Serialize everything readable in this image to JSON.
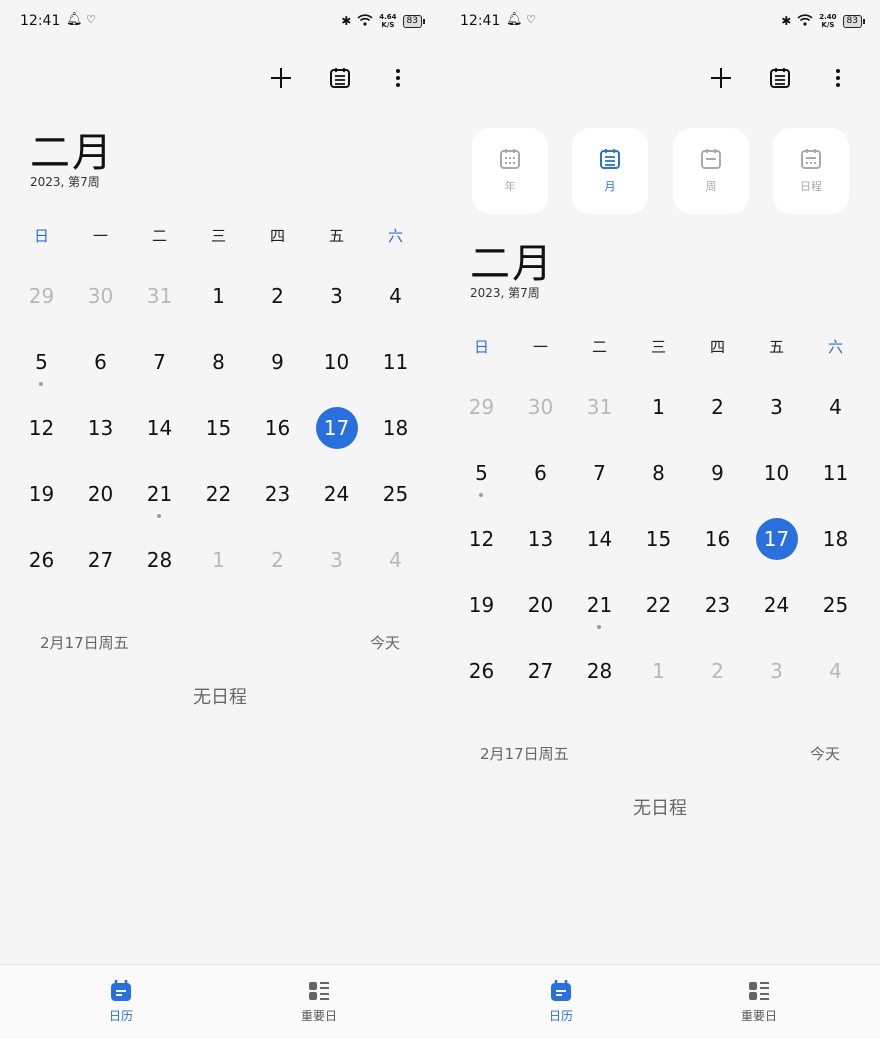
{
  "colors": {
    "accent": "#2a6fde",
    "muted": "#b8b8b8",
    "text": "#111111"
  },
  "status_bar": {
    "time": "12:41",
    "battery": "83",
    "speed_left": {
      "value": "4.64",
      "unit": "K/S"
    },
    "speed_right": {
      "value": "2.40",
      "unit": "K/S"
    },
    "icons": [
      "bell-icon",
      "heart-icon",
      "bluetooth-icon",
      "wifi-icon",
      "battery-icon"
    ]
  },
  "toolbar": {
    "icons": [
      "add-icon",
      "calendar-today-icon",
      "more-vertical-icon"
    ]
  },
  "view_switch": {
    "items": [
      {
        "label": "年",
        "icon": "calendar-year-icon",
        "active": false
      },
      {
        "label": "月",
        "icon": "calendar-month-icon",
        "active": true
      },
      {
        "label": "周",
        "icon": "calendar-week-icon",
        "active": false
      },
      {
        "label": "日程",
        "icon": "calendar-agenda-icon",
        "active": false
      }
    ]
  },
  "header": {
    "month": "二月",
    "subtitle": "2023, 第7周"
  },
  "calendar": {
    "weekdays": [
      "日",
      "一",
      "二",
      "三",
      "四",
      "五",
      "六"
    ],
    "selected_day": "17",
    "weeks": [
      [
        {
          "d": "29",
          "muted": true
        },
        {
          "d": "30",
          "muted": true
        },
        {
          "d": "31",
          "muted": true
        },
        {
          "d": "1"
        },
        {
          "d": "2"
        },
        {
          "d": "3"
        },
        {
          "d": "4"
        }
      ],
      [
        {
          "d": "5",
          "dot": true
        },
        {
          "d": "6"
        },
        {
          "d": "7"
        },
        {
          "d": "8"
        },
        {
          "d": "9"
        },
        {
          "d": "10"
        },
        {
          "d": "11"
        }
      ],
      [
        {
          "d": "12"
        },
        {
          "d": "13"
        },
        {
          "d": "14"
        },
        {
          "d": "15"
        },
        {
          "d": "16"
        },
        {
          "d": "17",
          "selected": true
        },
        {
          "d": "18"
        }
      ],
      [
        {
          "d": "19"
        },
        {
          "d": "20"
        },
        {
          "d": "21",
          "dot": true
        },
        {
          "d": "22"
        },
        {
          "d": "23"
        },
        {
          "d": "24"
        },
        {
          "d": "25"
        }
      ],
      [
        {
          "d": "26"
        },
        {
          "d": "27"
        },
        {
          "d": "28"
        },
        {
          "d": "1",
          "muted": true
        },
        {
          "d": "2",
          "muted": true
        },
        {
          "d": "3",
          "muted": true
        },
        {
          "d": "4",
          "muted": true
        }
      ]
    ]
  },
  "day_info": {
    "date": "2月17日周五",
    "today_label": "今天",
    "empty": "无日程"
  },
  "bottom_nav": {
    "tabs": [
      {
        "label": "日历",
        "icon": "calendar-tab-icon",
        "active": true
      },
      {
        "label": "重要日",
        "icon": "important-days-icon",
        "active": false
      }
    ]
  }
}
